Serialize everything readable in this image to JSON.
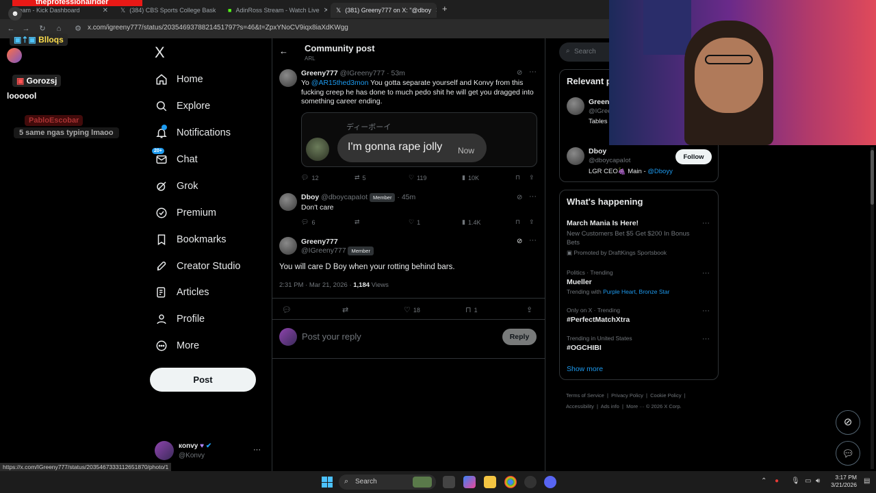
{
  "browser": {
    "tabs": [
      {
        "label": "Stream - Kick Dashboard"
      },
      {
        "label": "(384) CBS Sports College Bask"
      },
      {
        "label": "AdinRoss Stream - Watch Live"
      },
      {
        "label": "(381) Greeny777 on X: \"@dboy"
      }
    ],
    "new_tab": "+",
    "url": "x.com/igreeny777/status/2035469378821451797?s=46&t=ZpxYNoCV9iqx8iaXdKWgg",
    "status_url": "https://x.com/IGreeny777/status/2035467333112651870/photo/1"
  },
  "stream_overlay": {
    "streamer_title": "theprofessionalrider",
    "chat": [
      {
        "user": "Blloqs",
        "message": ""
      },
      {
        "user": "Gorozsj",
        "message": "loooool"
      },
      {
        "user": "PabloEscobar",
        "message": "5 same ngas typing lmaoo"
      }
    ]
  },
  "nav": {
    "logo": "X",
    "items": [
      {
        "label": "Home",
        "icon": "home-icon"
      },
      {
        "label": "Explore",
        "icon": "search-icon"
      },
      {
        "label": "Notifications",
        "icon": "bell-icon"
      },
      {
        "label": "Chat",
        "icon": "mail-icon",
        "badge": "20+"
      },
      {
        "label": "Grok",
        "icon": "grok-icon"
      },
      {
        "label": "Premium",
        "icon": "verified-icon"
      },
      {
        "label": "Bookmarks",
        "icon": "bookmark-icon"
      },
      {
        "label": "Creator Studio",
        "icon": "rocket-icon"
      },
      {
        "label": "Articles",
        "icon": "article-icon"
      },
      {
        "label": "Profile",
        "icon": "person-icon"
      },
      {
        "label": "More",
        "icon": "more-circle-icon"
      }
    ],
    "post_button": "Post",
    "account": {
      "name": "кonvy",
      "handle": "@Konvy",
      "more": "···"
    }
  },
  "header": {
    "back": "←",
    "title": "Community post",
    "subtitle": "ARL"
  },
  "thread": {
    "parent": {
      "name": "Greeny777",
      "handle": "@IGreeny777",
      "time": "· 53m",
      "text_mention": "@AR15thed3mon",
      "text_before": "Yo ",
      "text_after": " You gotta separate yourself and Konvy from this fucking creep he has done to much pedo shit he will get you dragged into something career ending.",
      "media": {
        "sender": "ディーボーイ",
        "bubble_text": "I'm gonna rape jolly",
        "bubble_time": "Now"
      },
      "stats": {
        "replies": "12",
        "reposts": "5",
        "likes": "119",
        "views": "10K"
      }
    },
    "reply": {
      "name": "Dboy",
      "handle": "@dboycapaIot",
      "badge": "Member",
      "time": "· 45m",
      "text": "Don't care",
      "stats": {
        "replies": "6",
        "reposts": "",
        "likes": "1",
        "views": "1.4K"
      }
    },
    "main": {
      "name": "Greeny777",
      "handle": "@IGreeny777",
      "badge": "Member",
      "text": "You will care D Boy when your rotting behind bars.",
      "timestamp": "2:31 PM · Mar 21, 2026 ·",
      "views_count": "1,184",
      "views_label": "Views",
      "stats": {
        "replies": "",
        "reposts": "",
        "likes": "18",
        "bookmarks": "1"
      }
    },
    "composer": {
      "placeholder": "Post your reply",
      "button": "Reply"
    }
  },
  "sidebar": {
    "search_placeholder": "Search",
    "relevant": {
      "title": "Relevant people",
      "people": [
        {
          "name": "Greeny777",
          "handle": "@IGreeny777",
          "bio": "Tables learn"
        },
        {
          "name": "Dboy",
          "handle": "@dboycapaIot",
          "bio_before": "LGR CEO🍇 Main - ",
          "bio_mention": "@Dboyy",
          "follow": "Follow"
        }
      ]
    },
    "happening": {
      "title": "What's happening",
      "items": [
        {
          "meta": "",
          "title": "March Mania Is Here!",
          "desc": "New Customers Bet $5 Get $200 In Bonus Bets",
          "promo": "Promoted by DraftKings Sportsbook"
        },
        {
          "meta": "Politics · Trending",
          "title": "Mueller",
          "trending_with_label": "Trending with",
          "trending_with": "Purple Heart, Bronze Star"
        },
        {
          "meta": "Only on X · Trending",
          "title": "#PerfectMatchXtra"
        },
        {
          "meta": "Trending in United States",
          "title": "#OGCHIBI"
        }
      ],
      "show_more": "Show more"
    },
    "footer": [
      "Terms of Service",
      "Privacy Policy",
      "Cookie Policy",
      "Accessibility",
      "Ads info",
      "More ···",
      "© 2026 X Corp."
    ]
  },
  "taskbar": {
    "search": "Search",
    "time": "3:17 PM",
    "date": "3/21/2026"
  },
  "colors": {
    "accent": "#1d9bf0",
    "background": "#000000",
    "border": "#2f3336",
    "muted": "#71767b"
  }
}
